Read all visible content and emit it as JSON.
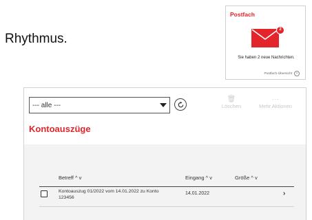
{
  "intro": {
    "text": "Rhythmus."
  },
  "postfach": {
    "title": "Postfach",
    "badge_count": "2",
    "message": "Sie haben 2 neue Nachrichten.",
    "link_label": "Postfach-Übersicht",
    "accent_color": "#e3242b"
  },
  "toolbar": {
    "filter_value": "--- alle ---",
    "delete_label": "Löschen",
    "more_label": "Mehr Aktionen"
  },
  "section": {
    "title": "Kontoauszüge"
  },
  "table": {
    "columns": {
      "betreff": "Betreff ^ v",
      "eingang": "Eingang ^ v",
      "groesse": "Größe ^ v"
    },
    "rows": [
      {
        "subject": "Kontoauszug 01/2022 vom 14.01.2022 zu Konto 123456",
        "date": "14.01.2022"
      }
    ]
  }
}
